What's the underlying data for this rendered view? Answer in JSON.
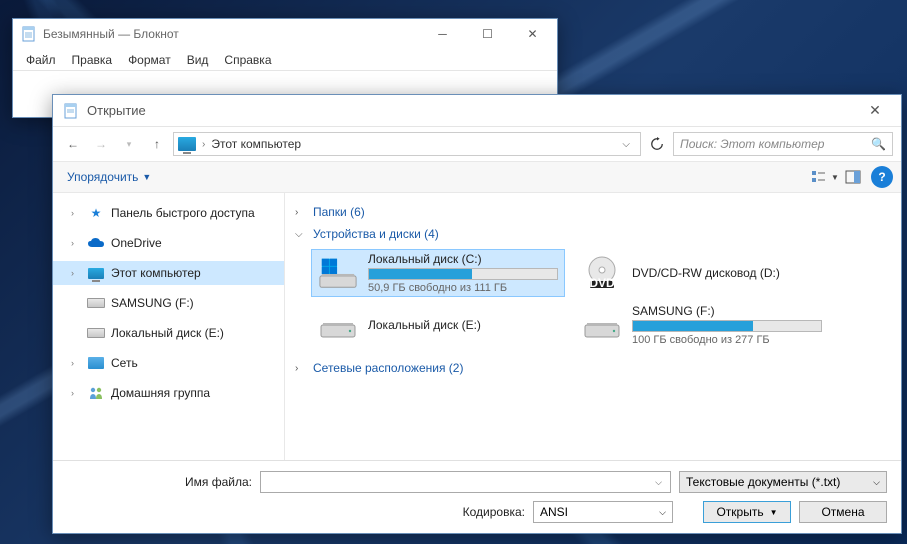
{
  "notepad": {
    "title": "Безымянный — Блокнот",
    "menu": {
      "file": "Файл",
      "edit": "Правка",
      "format": "Формат",
      "view": "Вид",
      "help": "Справка"
    }
  },
  "dialog": {
    "title": "Открытие",
    "location": "Этот компьютер",
    "search_placeholder": "Поиск: Этот компьютер",
    "organize": "Упорядочить",
    "sidebar": {
      "quick": "Панель быстрого доступа",
      "onedrive": "OneDrive",
      "thispc": "Этот компьютер",
      "samsung": "SAMSUNG (F:)",
      "locale": "Локальный диск (E:)",
      "network": "Сеть",
      "homegroup": "Домашняя группа"
    },
    "sections": {
      "folders": "Папки (6)",
      "drives": "Устройства и диски (4)",
      "netloc": "Сетевые расположения (2)"
    },
    "drives": {
      "c": {
        "name": "Локальный диск (C:)",
        "sub": "50,9 ГБ свободно из 111 ГБ",
        "pct": 55
      },
      "d": {
        "name": "DVD/CD-RW дисковод (D:)"
      },
      "e": {
        "name": "Локальный диск (E:)"
      },
      "f": {
        "name": "SAMSUNG (F:)",
        "sub": "100 ГБ свободно из 277 ГБ",
        "pct": 64
      }
    },
    "footer": {
      "filename_label": "Имя файла:",
      "encoding_label": "Кодировка:",
      "encoding_value": "ANSI",
      "filter": "Текстовые документы (*.txt)",
      "open": "Открыть",
      "cancel": "Отмена"
    }
  }
}
